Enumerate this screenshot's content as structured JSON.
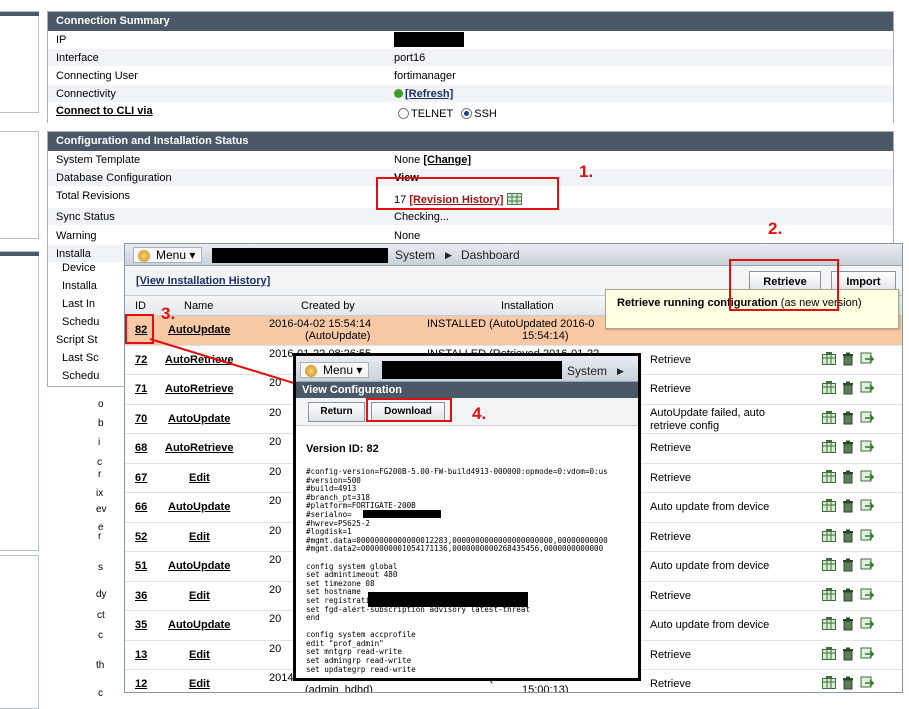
{
  "connection_summary": {
    "title": "Connection Summary",
    "rows": [
      {
        "label": "IP",
        "value": ""
      },
      {
        "label": "Interface",
        "value": "port16"
      },
      {
        "label": "Connecting User",
        "value": "fortimanager"
      },
      {
        "label": "Connectivity",
        "link": "[Refresh]"
      },
      {
        "label": "Connect to CLI via",
        "options": [
          "TELNET",
          "SSH"
        ],
        "selected": "SSH"
      }
    ]
  },
  "config_status": {
    "title": "Configuration and Installation Status",
    "rows": [
      {
        "label": "System Template",
        "value": "None",
        "link": "[Change]"
      },
      {
        "label": "Database Configuration",
        "link": "View"
      },
      {
        "label": "Total Revisions",
        "value": "17",
        "link": "[Revision History]"
      },
      {
        "label": "Sync Status",
        "value": "Checking..."
      },
      {
        "label": "Warning",
        "value": "None"
      },
      {
        "label": "Installa"
      }
    ],
    "sub_rows": [
      "Device",
      "Installa",
      "Last In",
      "Schedu",
      "Script St",
      "Last Sc",
      "Schedu"
    ]
  },
  "revision_window": {
    "menu_label": "Menu",
    "breadcrumb": [
      "System",
      "Dashboard"
    ],
    "history_link": "[View Installation History]",
    "retrieve_label": "Retrieve",
    "import_label": "Import",
    "tooltip_bold": "Retrieve running configuration",
    "tooltip_rest": " (as new version)",
    "columns": [
      "ID",
      "Name",
      "Created by",
      "Installation"
    ],
    "rows": [
      {
        "id": "82",
        "name": "AutoUpdate",
        "created_1": "2016-04-02 15:54:14",
        "created_2": "(AutoUpdate)",
        "inst_1": "INSTALLED (AutoUpdated 2016-0",
        "inst_2": "15:54:14)",
        "comment": "",
        "highlight": true
      },
      {
        "id": "72",
        "name": "AutoRetrieve",
        "created_1": "2016-01-22 08:26:55",
        "inst_1": "INSTALLED (Retrieved 2016-01-22",
        "comment": "Retrieve"
      },
      {
        "id": "71",
        "name": "AutoRetrieve",
        "created_1": "20",
        "comment": "Retrieve"
      },
      {
        "id": "70",
        "name": "AutoUpdate",
        "created_1": "20",
        "comment": "AutoUpdate failed, auto retrieve config"
      },
      {
        "id": "68",
        "name": "AutoRetrieve",
        "created_1": "20",
        "comment": "Retrieve"
      },
      {
        "id": "67",
        "name": "Edit",
        "created_1": "20",
        "comment": "Retrieve"
      },
      {
        "id": "66",
        "name": "AutoUpdate",
        "created_1": "20",
        "comment": "Auto update from device"
      },
      {
        "id": "52",
        "name": "Edit",
        "created_1": "20",
        "comment": "Retrieve"
      },
      {
        "id": "51",
        "name": "AutoUpdate",
        "created_1": "20",
        "comment": "Auto update from device"
      },
      {
        "id": "36",
        "name": "Edit",
        "created_1": "20",
        "comment": "Retrieve"
      },
      {
        "id": "35",
        "name": "AutoUpdate",
        "created_1": "20",
        "comment": "Auto update from device"
      },
      {
        "id": "13",
        "name": "Edit",
        "created_1": "20",
        "comment": "Retrieve"
      },
      {
        "id": "12",
        "name": "Edit",
        "created_1": "2014-10-28 15:36:22",
        "created_2": "(admin_hdhd)",
        "inst_1": "INSTALLED (Retrieved 2014-10-28",
        "inst_2": "15:00:13)",
        "comment": "Retrieve"
      }
    ]
  },
  "view_config": {
    "menu_label": "Menu",
    "breadcrumb": "System",
    "title": "View Configuration",
    "return_label": "Return",
    "download_label": "Download",
    "version": "Version ID:  82",
    "config_lines": [
      "#config-version=FG200B-5.00-FW-build4913-000000:opmode=0:vdom=0:us",
      "#version=500",
      "#build=4913",
      "#branch_pt=318",
      "#platform=FORTIGATE-200B",
      "#serialno=",
      "#hwrev=P5625-2",
      "#logdisk=1",
      "#mgmt.data=00000000000000012283,0000000000000000000000,00000000000",
      "#mgmt.data2=0000000001054171136,0000000000268435456,0000000000000",
      "",
      "config system global",
      "set admintimeout 480",
      "set timezone 08",
      "set hostname",
      "set registration-notification disable",
      "set fgd-alert-subscription advisory latest-threat",
      "end",
      "",
      "config system accprofile",
      "edit \"prof_admin\"",
      "set mntgrp read-write",
      "set admingrp read-write",
      "set updategrp read-write"
    ]
  },
  "annotations": [
    "1.",
    "2.",
    "3.",
    "4."
  ],
  "left_fragments": [
    "o",
    "b",
    "i",
    "c",
    "r",
    "ix",
    "ev",
    "e",
    "r",
    "s",
    "dy",
    "ct",
    "c",
    "th",
    "c"
  ],
  "colors": {
    "header": "#4a5867",
    "annotation": "#e01010",
    "highlight_row": "#f8c9a4",
    "link_red": "#a01515"
  }
}
